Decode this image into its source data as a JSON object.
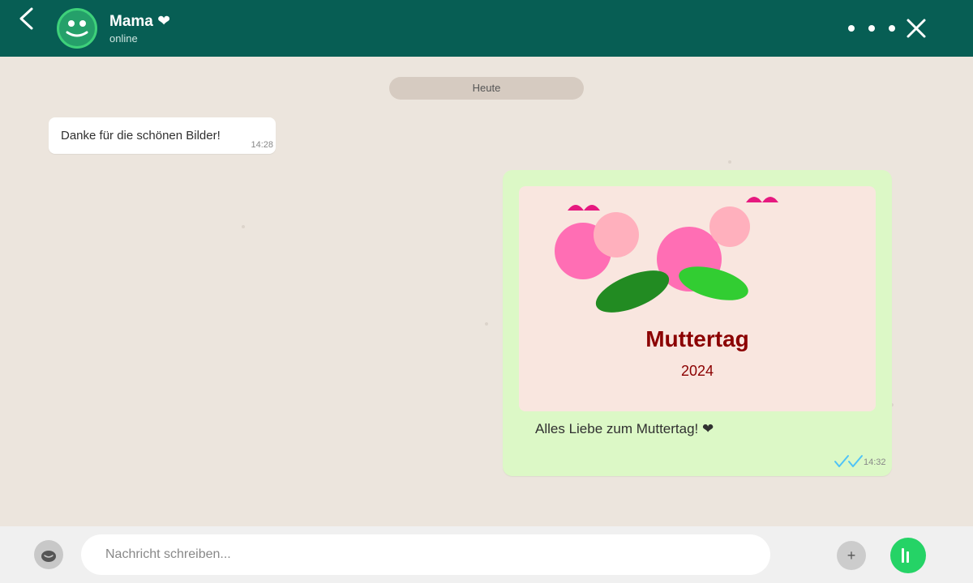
{
  "header": {
    "contact_name": "Mama ❤",
    "status": "online"
  },
  "chat": {
    "date_label": "Heute",
    "messages": [
      {
        "direction": "incoming",
        "text": "Danke für die schönen Bilder!",
        "time": "14:28"
      },
      {
        "direction": "outgoing",
        "card": {
          "title": "Muttertag",
          "year": "2024"
        },
        "text": "Alles Liebe zum Muttertag! ❤",
        "time": "14:32",
        "status": "read"
      }
    ]
  },
  "composer": {
    "placeholder": "Nachricht schreiben...",
    "attach_label": "+"
  },
  "icons": {
    "back": "chevron-left-icon",
    "avatar": "smiley-avatar-icon",
    "menu": "more-dots-icon",
    "close": "close-icon",
    "read": "double-check-icon",
    "emoji": "emoji-icon",
    "voice": "microphone-icon"
  },
  "colors": {
    "header": "#075e54",
    "chat_background": "#ece5dd",
    "outgoing_bubble": "#dcf8c6",
    "incoming_bubble": "#ffffff",
    "read_ticks": "#4fc3f7",
    "send_button": "#25d366",
    "card_title": "#8b0000"
  }
}
